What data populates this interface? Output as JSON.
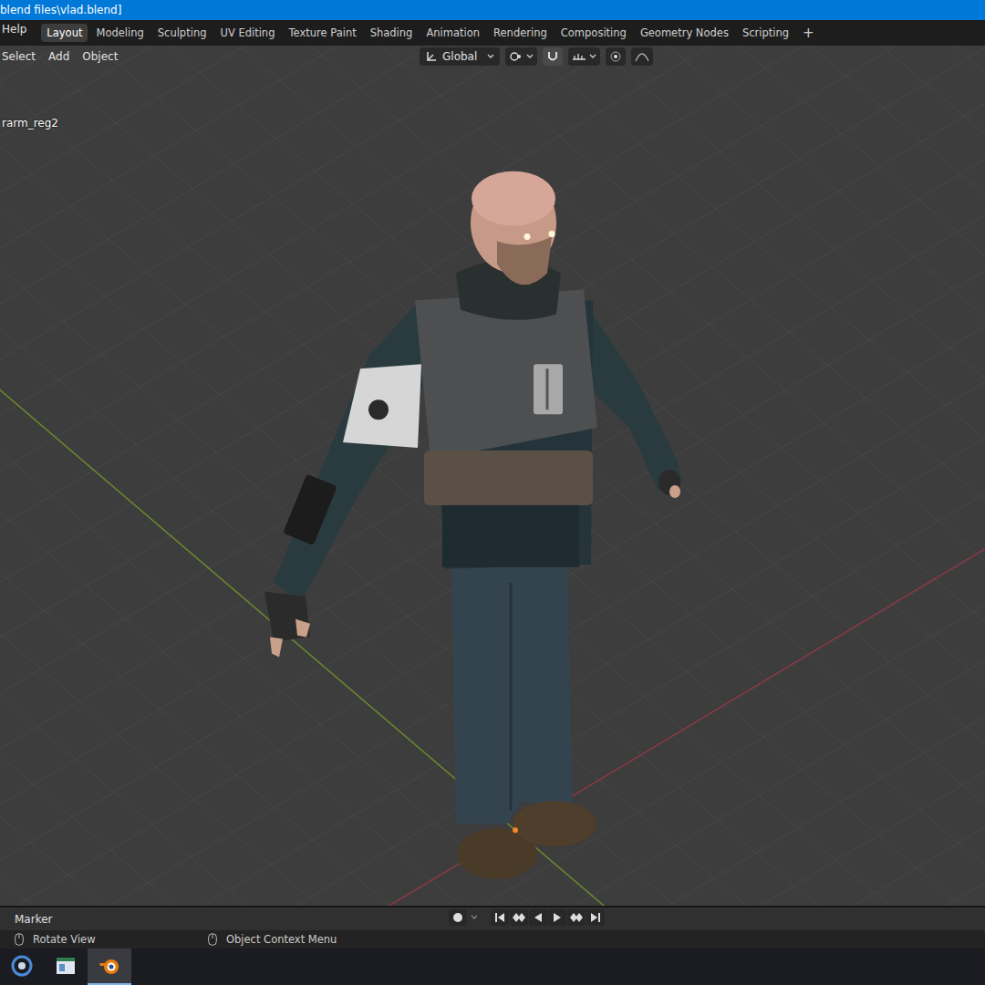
{
  "window": {
    "title": "blend files\\vlad.blend]"
  },
  "menu": [
    "Help"
  ],
  "workspace_tabs": [
    {
      "label": "Layout",
      "selected": true
    },
    {
      "label": "Modeling",
      "selected": false
    },
    {
      "label": "Sculpting",
      "selected": false
    },
    {
      "label": "UV Editing",
      "selected": false
    },
    {
      "label": "Texture Paint",
      "selected": false
    },
    {
      "label": "Shading",
      "selected": false
    },
    {
      "label": "Animation",
      "selected": false
    },
    {
      "label": "Rendering",
      "selected": false
    },
    {
      "label": "Compositing",
      "selected": false
    },
    {
      "label": "Geometry Nodes",
      "selected": false
    },
    {
      "label": "Scripting",
      "selected": false
    }
  ],
  "add_tab": "+",
  "viewport_header": {
    "menus": [
      "Select",
      "Add",
      "Object"
    ],
    "orientation": "Global"
  },
  "viewport": {
    "object_label": "rarm_reg2"
  },
  "timeline": {
    "label": "Marker"
  },
  "status_bar": [
    {
      "label": "Rotate View"
    },
    {
      "label": "Object Context Menu"
    }
  ]
}
